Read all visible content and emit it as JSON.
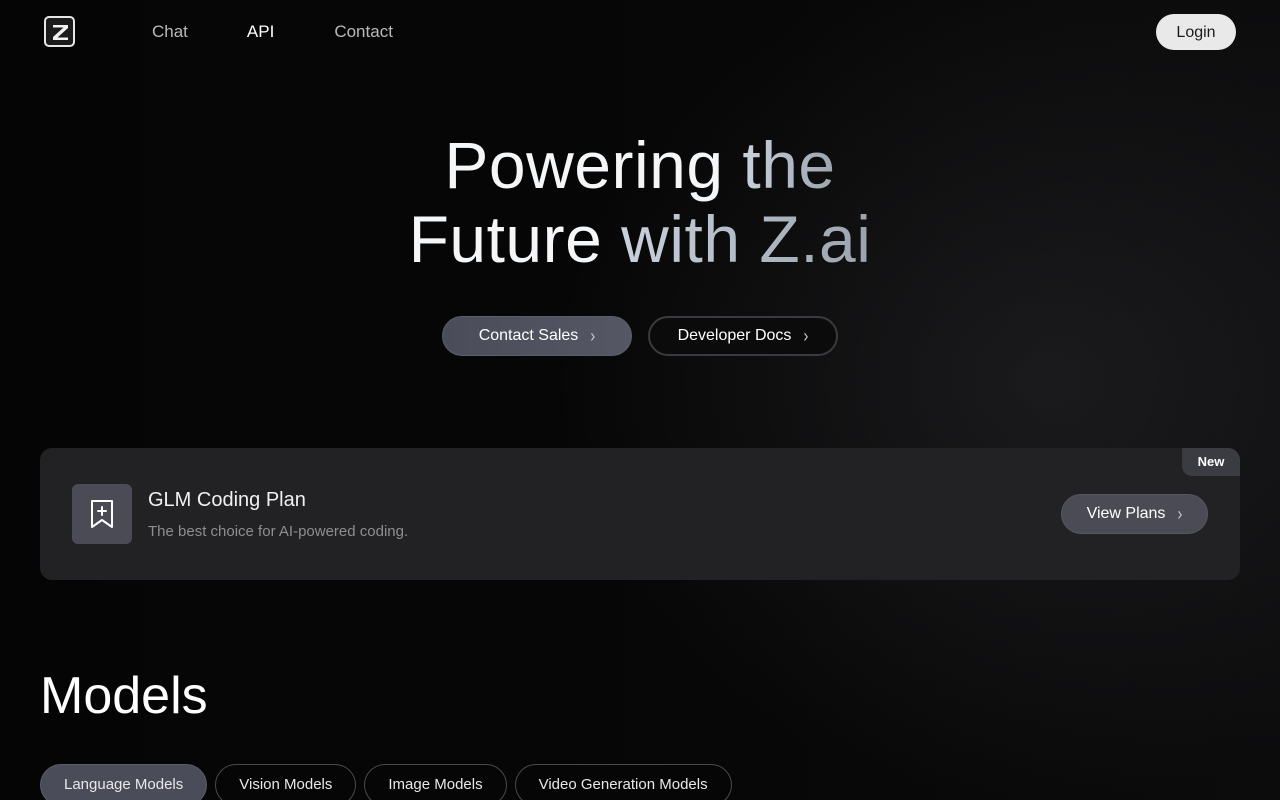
{
  "header": {
    "logo_icon": "z-logo-icon",
    "nav": [
      {
        "label": "Chat",
        "active": false
      },
      {
        "label": "API",
        "active": true
      },
      {
        "label": "Contact",
        "active": false
      }
    ],
    "login_label": "Login"
  },
  "hero": {
    "title_line1_a": "Powering",
    "title_line1_b": "the",
    "title_line2_a": "Future",
    "title_line2_b": "with Z.ai",
    "contact_sales_label": "Contact Sales",
    "developer_docs_label": "Developer Docs",
    "chevron_icon": "chevron-right-icon"
  },
  "promo": {
    "badge": "New",
    "icon": "bookmark-plus-icon",
    "title": "GLM Coding Plan",
    "subtitle": "The best choice for AI-powered coding.",
    "cta_label": "View Plans"
  },
  "models": {
    "title": "Models",
    "tabs": [
      {
        "label": "Language Models",
        "active": true
      },
      {
        "label": "Vision Models",
        "active": false
      },
      {
        "label": "Image Models",
        "active": false
      },
      {
        "label": "Video Generation Models",
        "active": false
      }
    ]
  },
  "colors": {
    "background": "#050505",
    "card": "#222225",
    "accent_button": "#4a4c59",
    "login_button": "#e9e9e9"
  }
}
